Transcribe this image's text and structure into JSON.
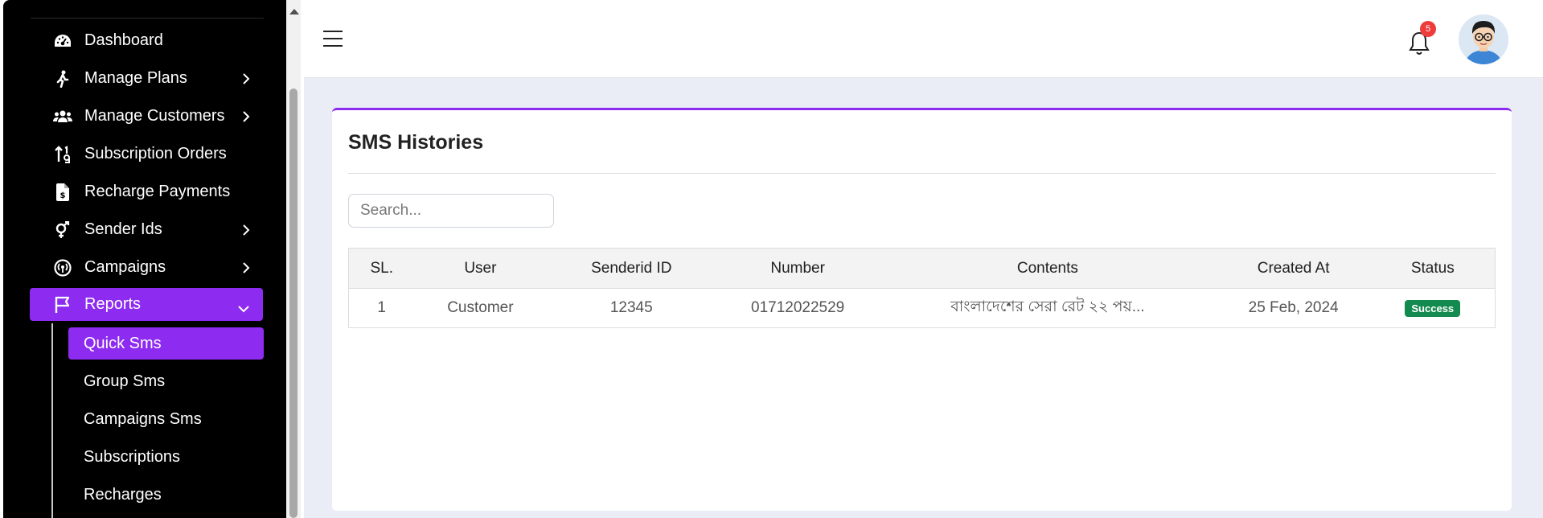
{
  "sidebar": {
    "items": [
      {
        "label": "Dashboard",
        "icon": "gauge-icon",
        "has_submenu": false
      },
      {
        "label": "Manage Plans",
        "icon": "walking-icon",
        "has_submenu": true
      },
      {
        "label": "Manage Customers",
        "icon": "users-icon",
        "has_submenu": true
      },
      {
        "label": "Subscription Orders",
        "icon": "sort-numeric-icon",
        "has_submenu": false
      },
      {
        "label": "Recharge Payments",
        "icon": "invoice-dollar-icon",
        "has_submenu": false
      },
      {
        "label": "Sender Ids",
        "icon": "venus-mars-icon",
        "has_submenu": true
      },
      {
        "label": "Campaigns",
        "icon": "broadcast-icon",
        "has_submenu": true
      },
      {
        "label": "Reports",
        "icon": "flag-icon",
        "has_submenu": true,
        "active": true
      }
    ],
    "reports_submenu": [
      {
        "label": "Quick Sms",
        "active": true
      },
      {
        "label": "Group Sms"
      },
      {
        "label": "Campaigns Sms"
      },
      {
        "label": "Subscriptions"
      },
      {
        "label": "Recharges"
      }
    ]
  },
  "header": {
    "notification_count": "5"
  },
  "card": {
    "title": "SMS Histories",
    "search_placeholder": "Search...",
    "columns": [
      "SL.",
      "User",
      "Senderid ID",
      "Number",
      "Contents",
      "Created At",
      "Status"
    ],
    "rows": [
      {
        "sl": "1",
        "user": "Customer",
        "senderid": "12345",
        "number": "01712022529",
        "contents": "বাংলাদেশের সেরা রেট ২২ পয়...",
        "created_at": "25 Feb, 2024",
        "status": "Success"
      }
    ]
  },
  "colors": {
    "accent": "#8d2bf0",
    "success": "#138a4f",
    "badge": "#ee3c3c"
  }
}
